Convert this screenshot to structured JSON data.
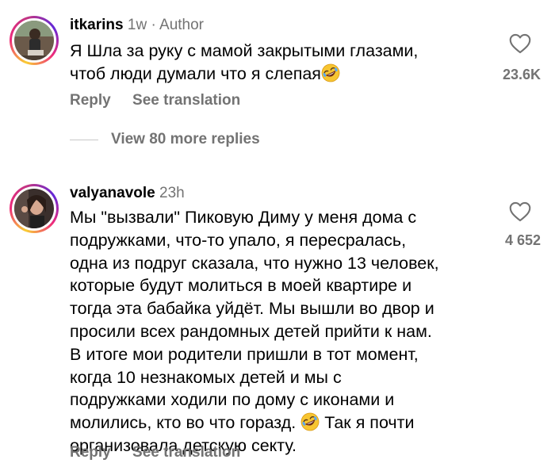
{
  "comments": [
    {
      "username": "itkarins",
      "time": "1w",
      "dot": "·",
      "author_badge": "Author",
      "lines": [
        "Я Шла за руку с мамой закрытыми глазами,",
        "чтоб люди думали что я слепая"
      ],
      "likes": "23.6K",
      "reply_label": "Reply",
      "translate_label": "See translation"
    },
    {
      "username": "valyanavole",
      "time": "23h",
      "lines": [
        "Мы \"вызвали\" Пиковую Диму у меня дома с",
        "подружками, что-то упало, я пересралась,",
        "одна из подруг сказала, что нужно 13 человек,",
        "которые будут молиться в моей квартире и",
        "тогда эта бабайка уйдёт. Мы вышли во двор и",
        "просили всех рандомных детей прийти к нам.",
        "В итоге мои родители пришли в тот момент,",
        "когда 10 незнакомых детей и мы с",
        "подружками ходили по дому с иконами и",
        "молились, кто во что горазд.",
        "Так я почти",
        "организовала детскую секту."
      ],
      "likes": "4 652",
      "reply_label": "Reply",
      "translate_label": "See translation"
    }
  ],
  "view_more_label": "View 80 more replies",
  "emoji_name": "rolling-on-the-floor-laughing-icon",
  "colors": {
    "secondary_text": "#737373",
    "ring_gradient": [
      "#f9ce34",
      "#ee2a7b",
      "#6228d7"
    ]
  }
}
